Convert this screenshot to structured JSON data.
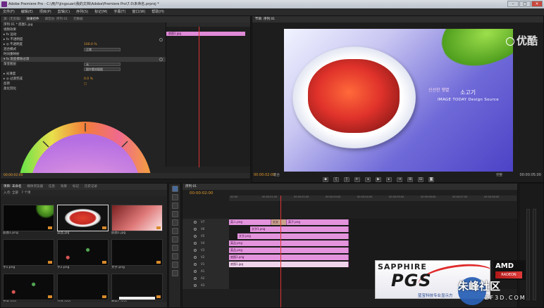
{
  "window": {
    "title": "Adobe Premiere Pro - C:\\用户\\jingxuan\\我的文档\\Adobe\\Premiere Pro\\7.0\\未命名.prproj *",
    "min_label": "–",
    "max_label": "□",
    "close_label": "×"
  },
  "menu": [
    "文件(F)",
    "编辑(E)",
    "项目(P)",
    "剪辑(C)",
    "序列(S)",
    "标记(M)",
    "字幕(T)",
    "窗口(W)",
    "帮助(H)"
  ],
  "source_tabs": [
    "源: (无剪辑)",
    "效果控件",
    "调音台: 序列 01",
    "元数据"
  ],
  "effect_controls": {
    "header": "序列 01 * 底图1.jpg",
    "rows": [
      {
        "label": "视频效果",
        "value": ""
      },
      {
        "label": "▸ fx 运动",
        "value": ""
      },
      {
        "label": "▸ fx 不透明度",
        "value": ""
      },
      {
        "label": "▸ ◎ 不透明度",
        "value": "100.0 %"
      },
      {
        "label": "混合模式",
        "select": "正常"
      },
      {
        "label": "时间重映射",
        "value": ""
      },
      {
        "label": "▾ fx 渐变擦除过渡",
        "value": "",
        "highlight": true
      },
      {
        "label": "渐变图层",
        "select": "无"
      },
      {
        "label": "",
        "select": "图中素材版图"
      },
      {
        "label": "▸ 光滑度",
        "value": ""
      },
      {
        "label": "▸ ◎ 过渡完成",
        "value": "0.0 %"
      },
      {
        "label": "反转",
        "value": "□"
      },
      {
        "label": "柔化羽化",
        "value": ""
      }
    ],
    "clip_label": "底图1.jpg",
    "footer_timecode": "00:00:02:00"
  },
  "program": {
    "tab": "节目: 序列 01",
    "timecode_current": "00:00:02:00",
    "timecode_duration": "00:00:05:00",
    "fit_label": "适合",
    "quality_label": "完整",
    "overlay_korean_small": "신선한 햇볕",
    "overlay_korean_main": "소고기",
    "overlay_english": "IMAGE TODAY Design Source",
    "watermark": "优酷",
    "transport": [
      "◆",
      "{",
      "}",
      "⇤",
      "◂",
      "▶",
      "▸",
      "⇥",
      "⊞",
      "⊟",
      "◙"
    ]
  },
  "project": {
    "tabs": [
      "项目: 未命名",
      "媒体浏览器",
      "信息",
      "效果",
      "标记",
      "历史记录"
    ],
    "filter_label": "入点: 全部",
    "count_label": "7 个项",
    "items": [
      {
        "label": "底图1.png",
        "style": "t-leaf"
      },
      {
        "label": "菜品.jpg",
        "style": "t-food",
        "selected": true
      },
      {
        "label": "底图1.jpg",
        "style": "t-pink"
      },
      {
        "label": "字1.png",
        "style": "t-dark"
      },
      {
        "label": "字2.png",
        "style": "t-dots"
      },
      {
        "label": "文字.png",
        "style": "t-dark"
      },
      {
        "label": "文字.png",
        "style": "t-dots"
      },
      {
        "label": "菜品.png",
        "style": "t-dark"
      },
      {
        "label": "图层1.png",
        "style": "t-white"
      }
    ]
  },
  "timeline": {
    "tab": "序列 01",
    "timecode": "00:00:02:00",
    "ruler": [
      "00:00",
      "00:00:01:00",
      "00:00:02:00",
      "00:00:03:00",
      "00:00:04:00",
      "00:00:05:00",
      "00:00:06:00",
      "00:00:07:00",
      "00:00:08:00"
    ],
    "tracks": [
      {
        "name": "V7",
        "clips": [
          {
            "label": "菜二.png",
            "start": 0,
            "width": 60
          },
          {
            "label": "交叉",
            "start": 60,
            "width": 22,
            "tone": "tan"
          },
          {
            "label": "菜子.png",
            "start": 82,
            "width": 88
          }
        ]
      },
      {
        "name": "V6",
        "clips": [
          {
            "label": "文字1.png",
            "start": 30,
            "width": 140
          }
        ]
      },
      {
        "name": "V5",
        "clips": [
          {
            "label": "文字.png",
            "start": 12,
            "width": 158
          }
        ]
      },
      {
        "name": "V4",
        "clips": [
          {
            "label": "菜品.png",
            "start": 0,
            "width": 170
          }
        ]
      },
      {
        "name": "V3",
        "clips": [
          {
            "label": "菜品.png",
            "start": 0,
            "width": 170
          }
        ]
      },
      {
        "name": "V2",
        "clips": [
          {
            "label": "底图1.png",
            "start": 0,
            "width": 170
          }
        ]
      },
      {
        "name": "V1",
        "clips": [
          {
            "label": "底图1.jpg",
            "start": 0,
            "width": 170,
            "tone": "light"
          }
        ]
      },
      {
        "name": "A1",
        "clips": []
      },
      {
        "name": "A2",
        "clips": []
      },
      {
        "name": "A3",
        "clips": []
      }
    ]
  },
  "ads": {
    "sapphire_brand": "SAPPHIRE",
    "sapphire_logo": "PGS",
    "sapphire_slogan": "蓝宝科技专业显示方",
    "amd_brand": "AMD",
    "amd_line": "RADEON",
    "site_name": "朱峰社区",
    "site_url": "ZF3D.COM"
  }
}
